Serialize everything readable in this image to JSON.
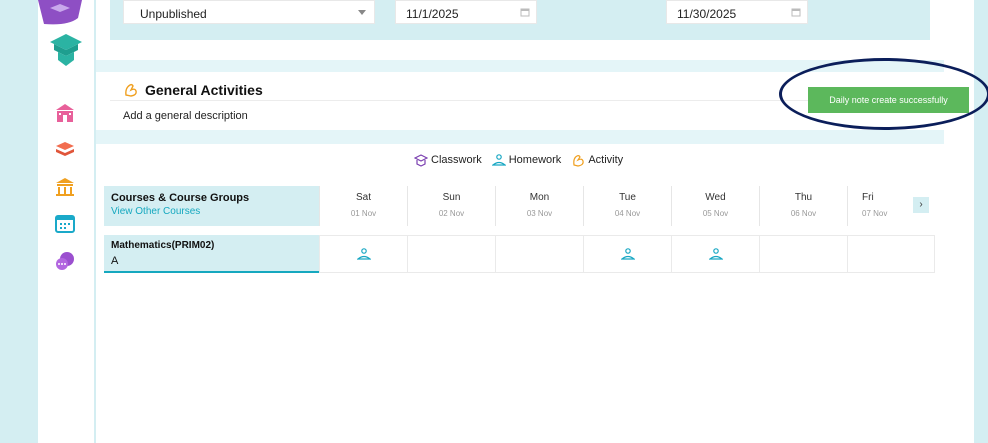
{
  "sidebar": {
    "icons": [
      "logo-icon",
      "school-icon",
      "books-icon",
      "institution-icon",
      "calendar-icon",
      "chat-icon"
    ]
  },
  "filters": {
    "status_value": "Unpublished",
    "start_date": "11/1/2025",
    "end_date": "11/30/2025"
  },
  "general_activities": {
    "title": "General Activities",
    "description": "Add a general description"
  },
  "legend": {
    "classwork": "Classwork",
    "homework": "Homework",
    "activity": "Activity"
  },
  "table": {
    "header_title": "Courses & Course Groups",
    "header_link": "View Other Courses",
    "days": [
      {
        "name": "Sat",
        "date": "01 Nov"
      },
      {
        "name": "Sun",
        "date": "02 Nov"
      },
      {
        "name": "Mon",
        "date": "03 Nov"
      },
      {
        "name": "Tue",
        "date": "04 Nov"
      },
      {
        "name": "Wed",
        "date": "05 Nov"
      },
      {
        "name": "Thu",
        "date": "06 Nov"
      },
      {
        "name": "Fri",
        "date": "07 Nov"
      }
    ],
    "next_label": "›",
    "rows": [
      {
        "course": "Mathematics(PRIM02)",
        "group": "A",
        "homework_days": [
          "Sat",
          "Tue",
          "Wed"
        ]
      }
    ]
  },
  "toast": {
    "message": "Daily note create successfully",
    "color": "#5cb85c"
  },
  "colors": {
    "accent": "#15a8bf",
    "panel_bg": "#d4eef2",
    "highlight_ring": "#0b1e5a"
  }
}
